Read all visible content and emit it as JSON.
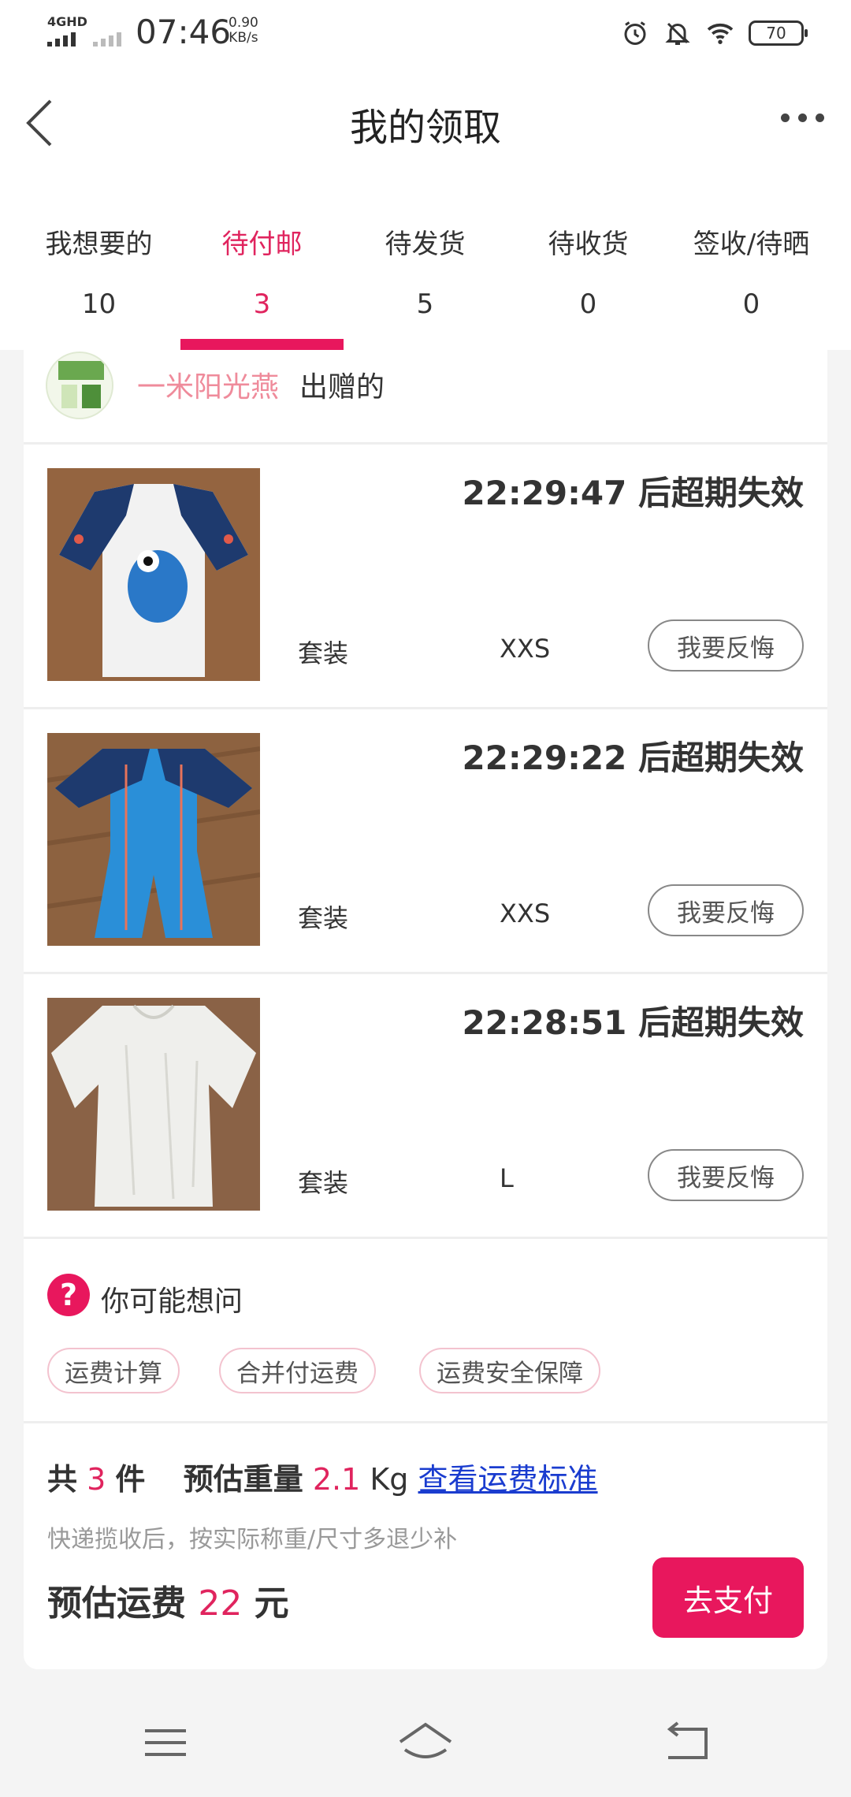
{
  "status_bar": {
    "network": "4GHD",
    "time": "07:46",
    "speed_value": "0.90",
    "speed_unit": "KB/s",
    "battery": "70"
  },
  "header": {
    "title": "我的领取"
  },
  "tabs": [
    {
      "label": "我想要的",
      "count": "10"
    },
    {
      "label": "待付邮",
      "count": "3"
    },
    {
      "label": "待发货",
      "count": "5"
    },
    {
      "label": "待收货",
      "count": "0"
    },
    {
      "label": "签收/待晒",
      "count": "0"
    }
  ],
  "giver": {
    "name": "一米阳光燕",
    "suffix": "出赠的"
  },
  "items": [
    {
      "timer": "22:29:47 后超期失效",
      "type": "套装",
      "size": "XXS",
      "action": "我要反悔"
    },
    {
      "timer": "22:29:22 后超期失效",
      "type": "套装",
      "size": "XXS",
      "action": "我要反悔"
    },
    {
      "timer": "22:28:51 后超期失效",
      "type": "套装",
      "size": "L",
      "action": "我要反悔"
    }
  ],
  "faq": {
    "title": "你可能想问",
    "chips": [
      "运费计算",
      "合并付运费",
      "运费安全保障"
    ]
  },
  "summary": {
    "count_prefix": "共",
    "count": "3",
    "count_suffix": "件",
    "weight_label": "预估重量",
    "weight": "2.1",
    "weight_unit": "Kg",
    "link": "查看运费标准",
    "note": "快递揽收后，按实际称重/尺寸多退少补",
    "fee_label": "预估运费",
    "fee": "22",
    "fee_unit": "元",
    "pay_button": "去支付"
  },
  "colors": {
    "accent": "#e8175d",
    "giver_name": "#ef8b9b",
    "link": "#1a3ccf"
  }
}
